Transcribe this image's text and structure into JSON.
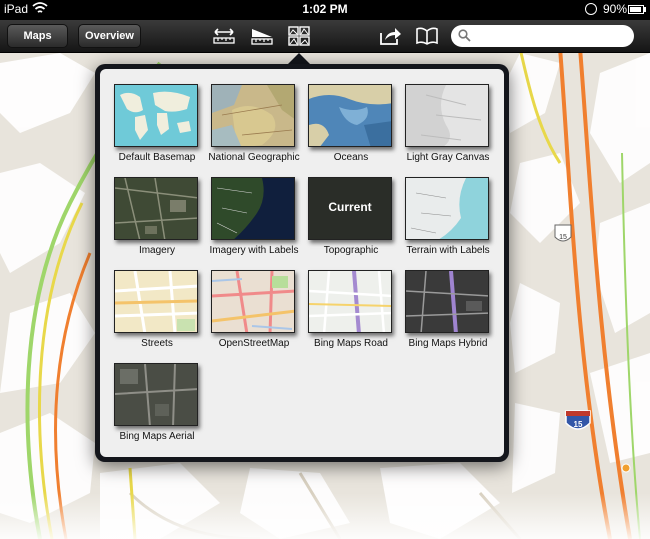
{
  "status_bar": {
    "carrier": "iPad",
    "time": "1:02 PM",
    "battery": "90%",
    "battery_level": 0.9
  },
  "toolbar": {
    "maps_label": "Maps",
    "overview_label": "Overview",
    "icons": [
      "measure-icon",
      "elevation-profile-icon",
      "basemap-gallery-icon",
      "share-icon",
      "bookmarks-icon"
    ],
    "search": {
      "value": "",
      "placeholder": ""
    }
  },
  "map": {
    "highway_shield": "15",
    "colors": {
      "background": "#e8e4dc",
      "terrain": "#ffffff",
      "highway": "#f07f2f",
      "road_yellow": "#e8d84a",
      "road_green": "#9fd66a"
    }
  },
  "basemap_gallery": {
    "current_badge": "Current",
    "items": [
      {
        "label": "Default Basemap"
      },
      {
        "label": "National Geographic"
      },
      {
        "label": "Oceans"
      },
      {
        "label": "Light Gray Canvas"
      },
      {
        "label": "Imagery"
      },
      {
        "label": "Imagery with Labels"
      },
      {
        "label": "Topographic",
        "current": true
      },
      {
        "label": "Terrain with Labels"
      },
      {
        "label": "Streets"
      },
      {
        "label": "OpenStreetMap"
      },
      {
        "label": "Bing Maps Road"
      },
      {
        "label": "Bing Maps Hybrid"
      },
      {
        "label": "Bing Maps Aerial"
      }
    ]
  }
}
